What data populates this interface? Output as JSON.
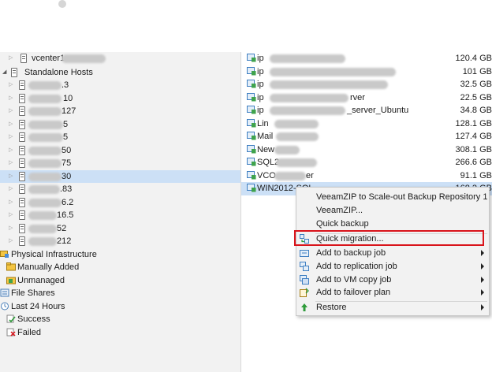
{
  "tree": {
    "vcenter": {
      "label": "vcenter1"
    },
    "standalone": {
      "label": "Standalone Hosts"
    },
    "hosts": [
      {
        "label": ".3"
      },
      {
        "label": "10"
      },
      {
        "label": "127"
      },
      {
        "label": "5"
      },
      {
        "label": "5"
      },
      {
        "label": "50"
      },
      {
        "label": "75"
      },
      {
        "label": "30"
      },
      {
        "label": ".83"
      },
      {
        "label": "6.2"
      },
      {
        "label": "16.5"
      },
      {
        "label": "52"
      },
      {
        "label": "212"
      }
    ],
    "categories": [
      {
        "label": "Physical Infrastructure"
      },
      {
        "label": "Manually Added"
      },
      {
        "label": "Unmanaged"
      },
      {
        "label": "File Shares"
      },
      {
        "label": "Last 24 Hours"
      },
      {
        "label": "Success"
      },
      {
        "label": "Failed"
      }
    ]
  },
  "vms": [
    {
      "name": "ip",
      "size": "120.4 GB"
    },
    {
      "name": "ip",
      "size": "101 GB"
    },
    {
      "name": "ip",
      "size": "32.5 GB"
    },
    {
      "name": "ip",
      "suffix": "rver",
      "size": "22.5 GB"
    },
    {
      "name": "ip",
      "suffix": "_server_Ubuntu",
      "size": "34.8 GB"
    },
    {
      "name": "Lin",
      "size": "128.1 GB"
    },
    {
      "name": "Mail",
      "size": "127.4 GB"
    },
    {
      "name": "New",
      "size": "308.1 GB"
    },
    {
      "name": "SQL2",
      "size": "266.6 GB"
    },
    {
      "name": "VCO",
      "suffix": "er",
      "size": "91.1 GB"
    },
    {
      "name": "WIN2012-SQL",
      "size": "168.2 GB"
    }
  ],
  "context_menu": {
    "items": [
      {
        "label": "VeeamZIP to Scale-out Backup Repository 1"
      },
      {
        "label": "VeeamZIP..."
      },
      {
        "label": "Quick backup"
      },
      {
        "label": "Quick migration..."
      },
      {
        "label": "Add to backup job"
      },
      {
        "label": "Add to replication job"
      },
      {
        "label": "Add to VM copy job"
      },
      {
        "label": "Add to failover plan"
      },
      {
        "label": "Restore"
      }
    ]
  },
  "colors": {
    "selection": "#cce0f6",
    "highlight_border": "#d9141b",
    "menu_bg": "#f2f2f2"
  }
}
